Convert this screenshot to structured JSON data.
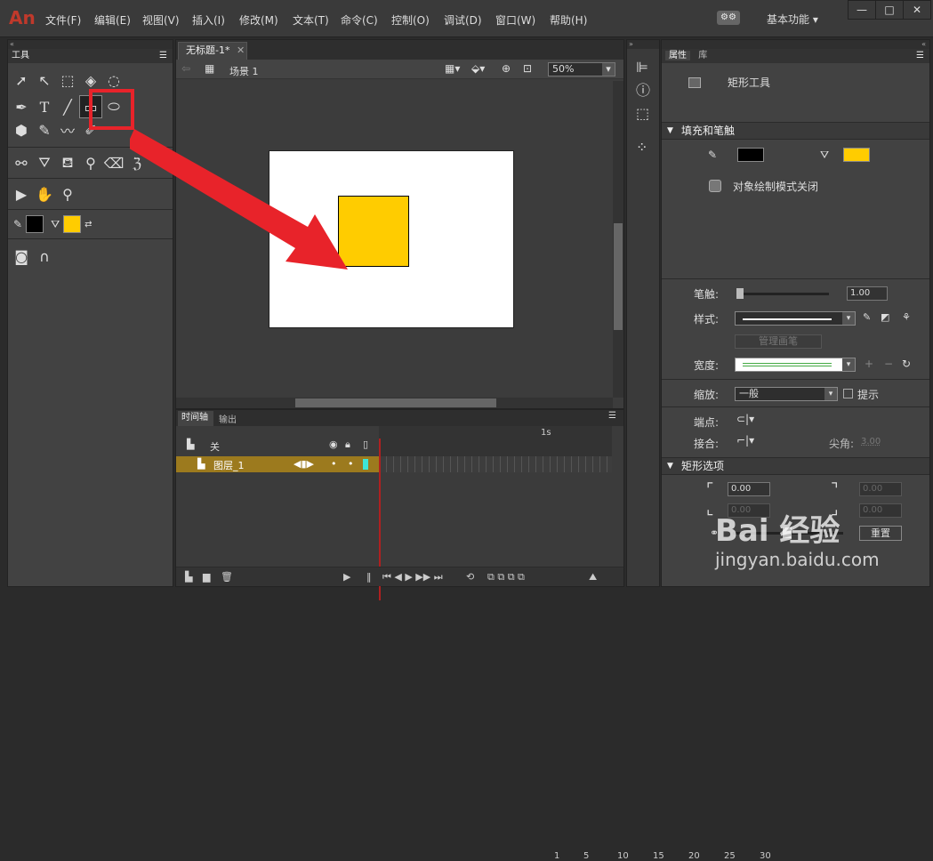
{
  "app": {
    "logo": "An",
    "workspace": "基本功能"
  },
  "menu": [
    "文件(F)",
    "编辑(E)",
    "视图(V)",
    "插入(I)",
    "修改(M)",
    "文本(T)",
    "命令(C)",
    "控制(O)",
    "调试(D)",
    "窗口(W)",
    "帮助(H)"
  ],
  "window_controls": [
    "—",
    "□",
    "✕"
  ],
  "tools_panel": {
    "title": "工具"
  },
  "document": {
    "tab": "无标题-1*",
    "scene": "场景 1",
    "zoom": "50%"
  },
  "stage": {
    "rect_color": "#ffcc00",
    "stroke_color": "#000000"
  },
  "timeline": {
    "tabs": [
      "时间轴",
      "输出"
    ],
    "layer_folder": "关",
    "layer_name": "图层_1",
    "frames": [
      "1",
      "5",
      "10",
      "15",
      "20",
      "25",
      "30"
    ],
    "second_marker": "1s"
  },
  "properties": {
    "tabs": [
      "属性",
      "库"
    ],
    "tool_name": "矩形工具",
    "fill_stroke_section": "填充和笔触",
    "stroke_color": "#000000",
    "fill_color": "#ffcc00",
    "object_mode": "对象绘制模式关闭",
    "stroke_label": "笔触:",
    "stroke_value": "1.00",
    "style_label": "样式:",
    "manage_brush": "管理画笔",
    "width_label": "宽度:",
    "scale_label": "缩放:",
    "scale_value": "一般",
    "hint_label": "提示",
    "cap_label": "端点:",
    "join_label": "接合:",
    "miter_label": "尖角:",
    "miter_value": "3.00",
    "rect_section": "矩形选项",
    "corner_values": [
      "0.00",
      "0.00",
      "0.00",
      "0.00"
    ],
    "reset_button": "重置"
  },
  "watermark": {
    "brand": "Bai 经验",
    "url": "jingyan.baidu.com"
  }
}
